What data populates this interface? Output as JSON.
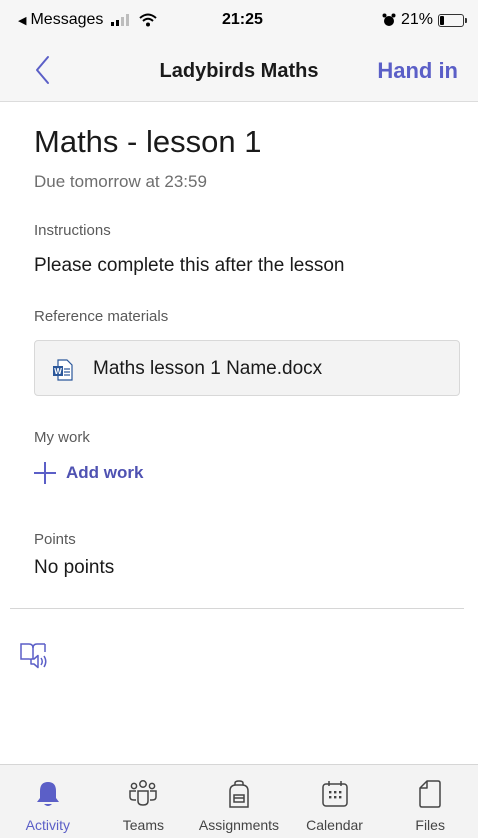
{
  "status_bar": {
    "back_app": "Messages",
    "time": "21:25",
    "battery_percent": "21%",
    "battery_level": 0.21
  },
  "nav": {
    "title": "Ladybirds Maths",
    "hand_in_label": "Hand in"
  },
  "assignment": {
    "title": "Maths - lesson 1",
    "due": "Due tomorrow at 23:59",
    "instructions_label": "Instructions",
    "instructions": "Please complete this after the lesson",
    "reference_label": "Reference materials",
    "reference_file": "Maths lesson 1 Name.docx",
    "my_work_label": "My work",
    "add_work_label": "Add work",
    "points_label": "Points",
    "points_value": "No points"
  },
  "tabs": [
    {
      "label": "Activity",
      "icon": "bell-icon",
      "active": true
    },
    {
      "label": "Teams",
      "icon": "teams-icon",
      "active": false
    },
    {
      "label": "Assignments",
      "icon": "backpack-icon",
      "active": false
    },
    {
      "label": "Calendar",
      "icon": "calendar-icon",
      "active": false
    },
    {
      "label": "Files",
      "icon": "file-icon",
      "active": false
    }
  ],
  "colors": {
    "accent": "#5b5fc7",
    "word_blue": "#2b579a"
  }
}
